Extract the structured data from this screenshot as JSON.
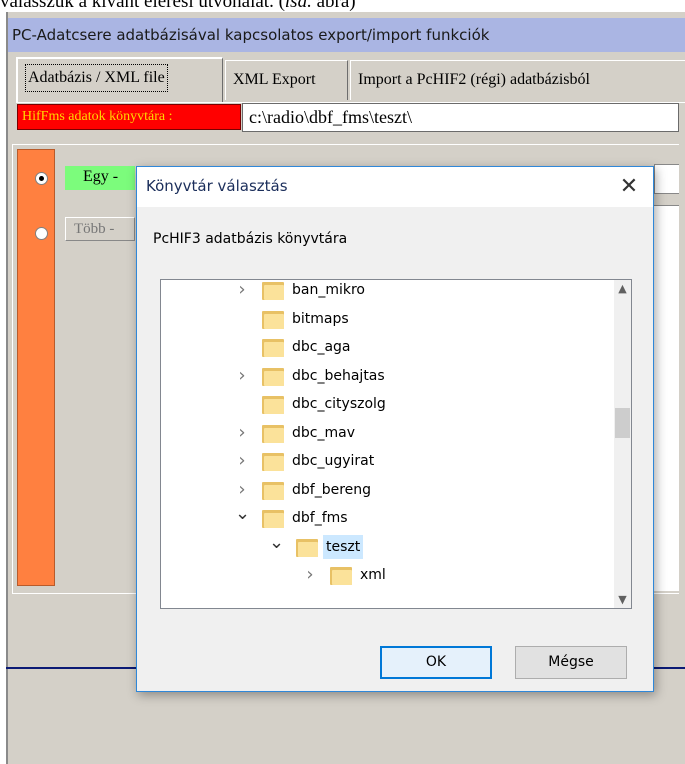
{
  "caption": {
    "prefix": "válasszuk a kívánt elérési útvonalat. (",
    "italic": "lsd.",
    "suffix": " ábra)"
  },
  "window": {
    "title": "PC-Adatcsere adatbázisával kapcsolatos export/import funkciók"
  },
  "tabs": [
    {
      "label": "Adatbázis / XML file",
      "active": true
    },
    {
      "label": "XML Export",
      "active": false
    },
    {
      "label": "Import a PcHIF2 (régi) adatbázisból",
      "active": false
    }
  ],
  "path": {
    "label": "HifFms adatok könyvtára :",
    "value": "c:\\radio\\dbf_fms\\teszt\\"
  },
  "options": [
    {
      "label": "Egy -",
      "selected": true
    },
    {
      "label": "Több -",
      "selected": false
    }
  ],
  "dialog": {
    "title": "Könyvtár választás",
    "close_glyph": "✕",
    "prompt": "PcHIF3 adatbázis könyvtára",
    "tree": [
      {
        "label": "ban_mikro",
        "chevron": "collapsed",
        "level": 0,
        "selected": false
      },
      {
        "label": "bitmaps",
        "chevron": "none",
        "level": 0,
        "selected": false
      },
      {
        "label": "dbc_aga",
        "chevron": "none",
        "level": 0,
        "selected": false
      },
      {
        "label": "dbc_behajtas",
        "chevron": "collapsed",
        "level": 0,
        "selected": false
      },
      {
        "label": "dbc_cityszolg",
        "chevron": "none",
        "level": 0,
        "selected": false
      },
      {
        "label": "dbc_mav",
        "chevron": "collapsed",
        "level": 0,
        "selected": false
      },
      {
        "label": "dbc_ugyirat",
        "chevron": "collapsed",
        "level": 0,
        "selected": false
      },
      {
        "label": "dbf_bereng",
        "chevron": "collapsed",
        "level": 0,
        "selected": false
      },
      {
        "label": "dbf_fms",
        "chevron": "expanded",
        "level": 0,
        "selected": false
      },
      {
        "label": "teszt",
        "chevron": "expanded",
        "level": 1,
        "selected": true
      },
      {
        "label": "xml",
        "chevron": "collapsed",
        "level": 2,
        "selected": false
      }
    ],
    "scroll_up_glyph": "▲",
    "scroll_down_glyph": "▼",
    "ok_label": "OK",
    "cancel_label": "Mégse"
  },
  "colors": {
    "title_bar": "#aab5e3",
    "orange_bar": "#ff8040",
    "path_label_bg": "#ff0000",
    "path_label_text": "#ffd700",
    "option_green": "#7cfc7c",
    "selection": "#cce8ff",
    "dialog_border": "#2f87d8"
  }
}
